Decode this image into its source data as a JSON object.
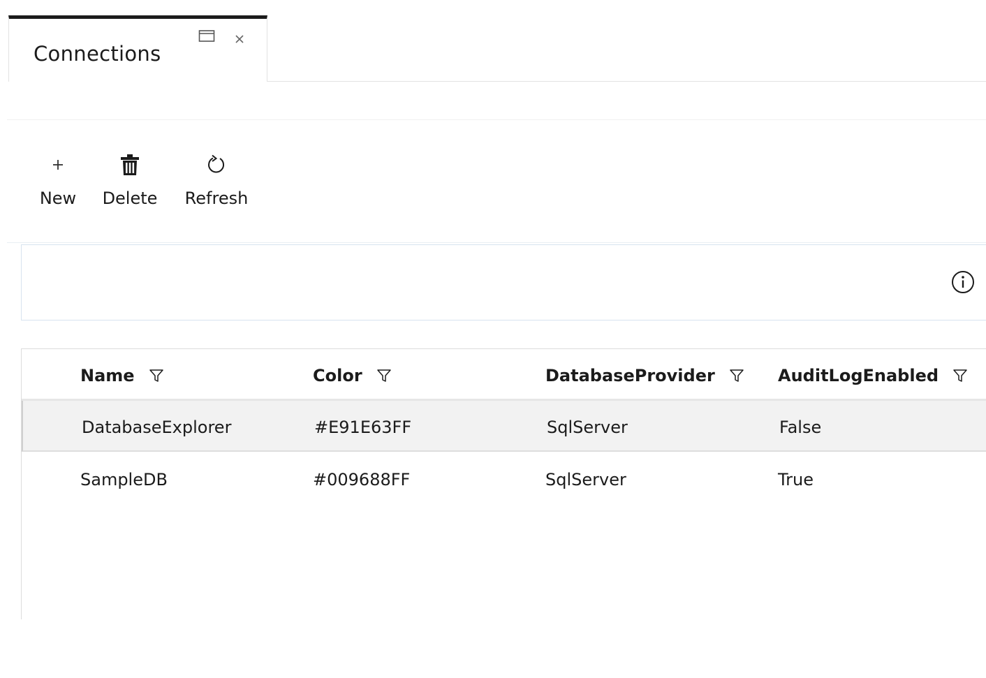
{
  "tab": {
    "title": "Connections",
    "restore_icon": "restore-window-icon",
    "close_icon": "close-icon"
  },
  "toolbar": {
    "new_label": "New",
    "delete_label": "Delete",
    "refresh_label": "Refresh",
    "new_icon": "plus-icon",
    "delete_icon": "trash-icon",
    "refresh_icon": "refresh-icon"
  },
  "info": {
    "icon": "info-icon"
  },
  "grid": {
    "columns": [
      "Name",
      "Color",
      "DatabaseProvider",
      "AuditLogEnabled"
    ],
    "filter_icon": "filter-icon",
    "rows": [
      {
        "name": "DatabaseExplorer",
        "color": "#E91E63FF",
        "provider": "SqlServer",
        "audit": "False",
        "selected": true
      },
      {
        "name": "SampleDB",
        "color": "#009688FF",
        "provider": "SqlServer",
        "audit": "True",
        "selected": false
      }
    ]
  },
  "colors": {
    "text": "#1b1b1b",
    "tab_accent": "#1b1b1b",
    "selected_row_bg": "#f2f2f2",
    "info_border": "#d7e3ef"
  }
}
